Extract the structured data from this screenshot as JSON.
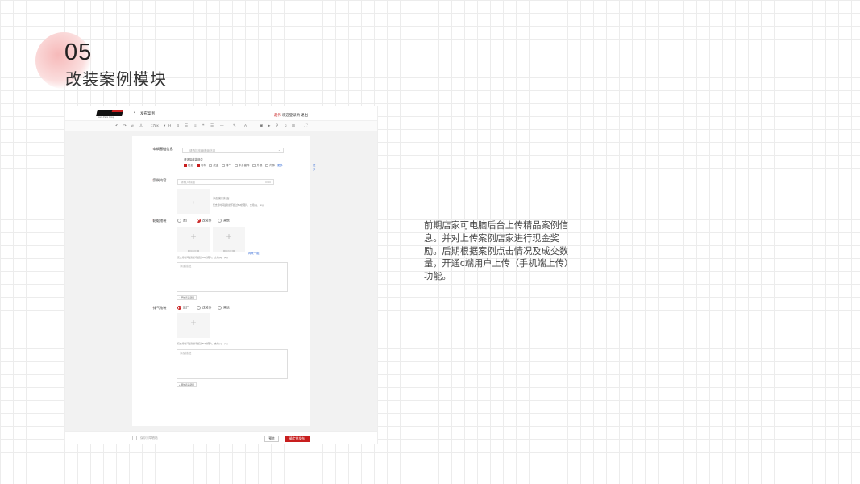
{
  "slide": {
    "number": "05",
    "title": "改装案例模块",
    "description": "前期店家可电脑后台上传精品案例信息。并对上传案例店家进行现金奖励。后期根据案例点击情况及成交数量，开通c端用户上传（手机端上传）功能。"
  },
  "app": {
    "back_icon": "chevron-left-icon",
    "page_name": "发布案例",
    "welcome_red": "起伟",
    "welcome_text": " 欢迎登录哟 退出",
    "logo_tagline": "Auto Parts Group",
    "toolbar": {
      "font_size": "17px"
    },
    "form": {
      "vehicle": {
        "label": "车辆基础信息",
        "placeholder": "请选择车辆基础信息",
        "tags_label": "请选择改装部位",
        "options": [
          {
            "label": "轮毂",
            "checked": true
          },
          {
            "label": "刹车",
            "checked": true
          },
          {
            "label": "底盘",
            "checked": false
          },
          {
            "label": "排气",
            "checked": false
          },
          {
            "label": "车身套件",
            "checked": false
          },
          {
            "label": "外观",
            "checked": false
          },
          {
            "label": "内饰",
            "checked": false
          }
        ],
        "more_link": "更多",
        "side_link": "更多"
      },
      "content": {
        "label": "案例内容",
        "title_placeholder": "请输入标题",
        "title_counter": "0/30",
        "cover_label": "添加案例封面",
        "cover_hint": "仅支持时间最新的不超过5M的图片，支持jpg、png"
      },
      "wheel": {
        "label": "轮毂改装",
        "radios": [
          {
            "label": "原厂",
            "on": false
          },
          {
            "label": "改装件",
            "on": true
          },
          {
            "label": "其他",
            "on": false
          }
        ],
        "upload_tag_1": "设为封面",
        "upload_tag_2": "设为封面",
        "add_link": "再来一组",
        "hint": "仅支持时间最新的不超过5M的图片，支持jpg、png",
        "textarea_placeholder": "添加描述",
        "add_button": "添加商品链接"
      },
      "exhaust": {
        "label": "排气改装",
        "radios": [
          {
            "label": "原厂",
            "on": true
          },
          {
            "label": "改装件",
            "on": false
          },
          {
            "label": "其他",
            "on": false
          }
        ],
        "hint": "仅支持时间最新的不超过5M的图片，支持jpg、png",
        "textarea_placeholder": "添加描述",
        "add_button": "添加商品链接"
      }
    },
    "footer": {
      "draft_label": "保存到草稿箱",
      "preview": "预览",
      "publish": "确定并发布"
    }
  }
}
